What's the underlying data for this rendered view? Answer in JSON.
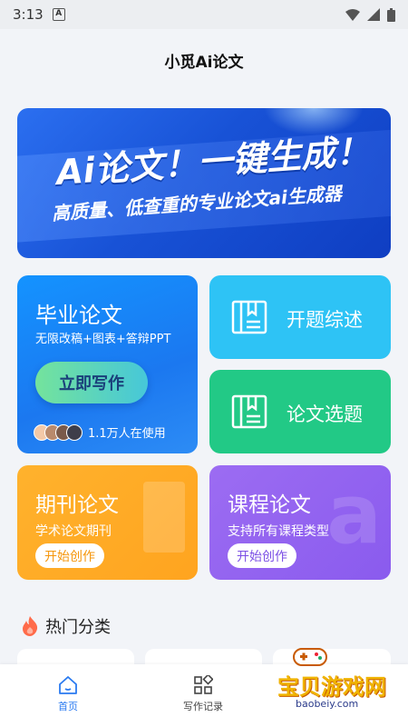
{
  "status_bar": {
    "time": "3:13",
    "notification_badge": "A"
  },
  "header": {
    "title": "小觅Ai论文"
  },
  "banner": {
    "headline": "Ai论文！一键生成！",
    "subline": "高质量、低查重的专业论文ai生成器"
  },
  "graduation_card": {
    "title": "毕业论文",
    "subtitle": "无限改稿+图表+答辩PPT",
    "button": "立即写作",
    "users_text": "1.1万人在使用"
  },
  "tiles": [
    {
      "label": "开题综述",
      "color": "#2ec3f5"
    },
    {
      "label": "论文选题",
      "color": "#22c986"
    }
  ],
  "journal_card": {
    "title": "期刊论文",
    "subtitle": "学术论文期刊",
    "button": "开始创作"
  },
  "course_card": {
    "title": "课程论文",
    "subtitle": "支持所有课程类型",
    "button": "开始创作"
  },
  "hot_section": {
    "title": "热门分类"
  },
  "bottom_nav": [
    {
      "label": "首页",
      "icon": "home-icon",
      "active": true
    },
    {
      "label": "写作记录",
      "icon": "grid-icon",
      "active": false
    }
  ],
  "watermark": {
    "text": "宝贝游戏网",
    "url": "baobeiy.com"
  },
  "colors": {
    "accent": "#2a7af0",
    "orange": "#ffac26",
    "purple": "#9366f0"
  }
}
